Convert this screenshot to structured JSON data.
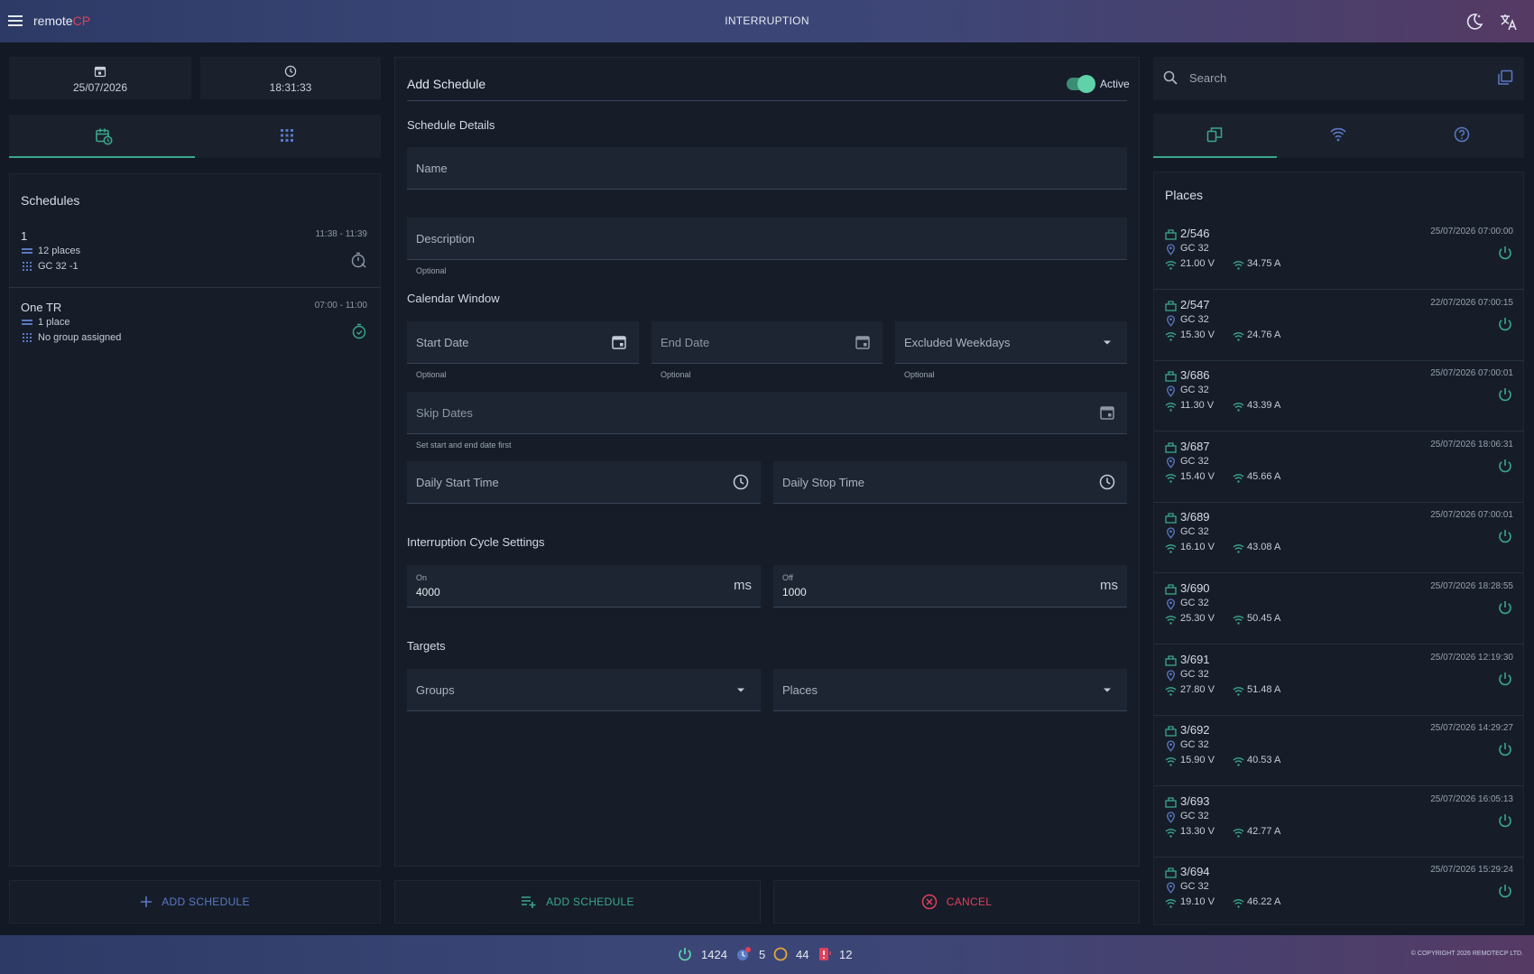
{
  "app": {
    "brand_prefix": "remote",
    "brand_suffix": "CP",
    "page_title": "INTERRUPTION",
    "accent": "#3aa78a",
    "brand_color": "#e0405a"
  },
  "left": {
    "date": "25/07/2026",
    "time": "18:31:33",
    "schedules_title": "Schedules",
    "schedules": [
      {
        "name": "1",
        "time": "11:38 - 11:39",
        "places": "12 places",
        "group": "GC 32 -1"
      },
      {
        "name": "One TR",
        "time": "07:00 - 11:00",
        "places": "1 place",
        "group": "No group assigned"
      }
    ],
    "add_schedule_label": "ADD SCHEDULE"
  },
  "form": {
    "title": "Add Schedule",
    "active_label": "Active",
    "active": true,
    "details_title": "Schedule Details",
    "name_placeholder": "Name",
    "description_placeholder": "Description",
    "description_hint": "Optional",
    "calendar_title": "Calendar Window",
    "start_date_placeholder": "Start Date",
    "start_date_hint": "Optional",
    "end_date_placeholder": "End Date",
    "end_date_hint": "Optional",
    "excluded_weekdays_placeholder": "Excluded Weekdays",
    "excluded_weekdays_hint": "Optional",
    "skip_dates_placeholder": "Skip Dates",
    "skip_dates_hint": "Set start and end date first",
    "daily_start_placeholder": "Daily Start Time",
    "daily_stop_placeholder": "Daily Stop Time",
    "cycle_title": "Interruption Cycle Settings",
    "on_label": "On",
    "on_value": "4000",
    "on_unit": "ms",
    "off_label": "Off",
    "off_value": "1000",
    "off_unit": "ms",
    "targets_title": "Targets",
    "groups_placeholder": "Groups",
    "places_placeholder": "Places",
    "submit_label": "ADD SCHEDULE",
    "cancel_label": "CANCEL"
  },
  "right": {
    "search_placeholder": "Search",
    "places_title": "Places",
    "places": [
      {
        "id": "2/546",
        "ts": "25/07/2026 07:00:00",
        "gc": "GC 32",
        "v": "21.00 V",
        "a": "34.75 A"
      },
      {
        "id": "2/547",
        "ts": "22/07/2026 07:00:15",
        "gc": "GC 32",
        "v": "15.30 V",
        "a": "24.76 A"
      },
      {
        "id": "3/686",
        "ts": "25/07/2026 07:00:01",
        "gc": "GC 32",
        "v": "11.30 V",
        "a": "43.39 A"
      },
      {
        "id": "3/687",
        "ts": "25/07/2026 18:06:31",
        "gc": "GC 32",
        "v": "15.40 V",
        "a": "45.66 A"
      },
      {
        "id": "3/689",
        "ts": "25/07/2026 07:00:01",
        "gc": "GC 32",
        "v": "16.10 V",
        "a": "43.08 A"
      },
      {
        "id": "3/690",
        "ts": "25/07/2026 18:28:55",
        "gc": "GC 32",
        "v": "25.30 V",
        "a": "50.45 A"
      },
      {
        "id": "3/691",
        "ts": "25/07/2026 12:19:30",
        "gc": "GC 32",
        "v": "27.80 V",
        "a": "51.48 A"
      },
      {
        "id": "3/692",
        "ts": "25/07/2026 14:29:27",
        "gc": "GC 32",
        "v": "15.90 V",
        "a": "40.53 A"
      },
      {
        "id": "3/693",
        "ts": "25/07/2026 16:05:13",
        "gc": "GC 32",
        "v": "13.30 V",
        "a": "42.77 A"
      },
      {
        "id": "3/694",
        "ts": "25/07/2026 15:29:24",
        "gc": "GC 32",
        "v": "19.10 V",
        "a": "46.22 A"
      }
    ]
  },
  "status": {
    "power_count": "1424",
    "interrupt_count": "5",
    "circle_count": "44",
    "alert_count": "12",
    "copyright": "© COPYRIGHT 2026 REMOTECP LTD."
  }
}
